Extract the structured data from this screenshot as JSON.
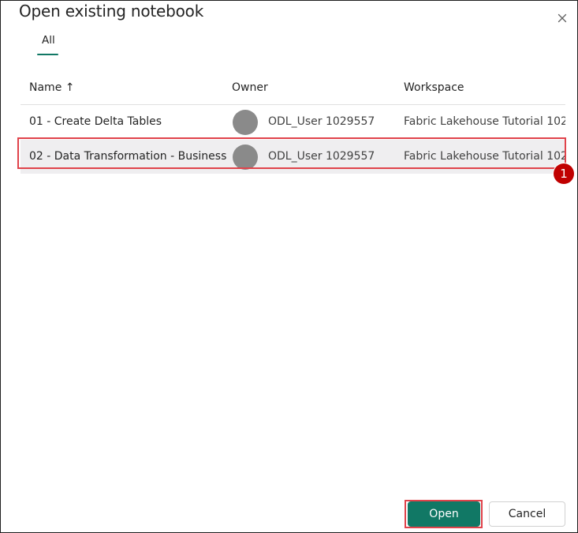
{
  "dialog": {
    "title": "Open existing notebook",
    "close_icon": "close-icon"
  },
  "tabs": [
    {
      "label": "All",
      "selected": true
    }
  ],
  "table": {
    "columns": {
      "name": "Name ↑",
      "owner": "Owner",
      "workspace": "Workspace"
    },
    "rows": [
      {
        "name": "01 - Create Delta Tables",
        "owner": "ODL_User 1029557",
        "workspace": "Fabric Lakehouse Tutorial 102",
        "selected": false
      },
      {
        "name": "02 - Data Transformation - Business",
        "owner": "ODL_User 1029557",
        "workspace": "Fabric Lakehouse Tutorial 102",
        "selected": true
      }
    ]
  },
  "annotation": {
    "step_number": "1",
    "highlight_color": "#e0434b",
    "badge_color": "#c00000"
  },
  "footer": {
    "open_label": "Open",
    "cancel_label": "Cancel"
  },
  "colors": {
    "accent": "#117865",
    "selected_row": "#efeef0",
    "avatar": "#8a8a8a"
  }
}
